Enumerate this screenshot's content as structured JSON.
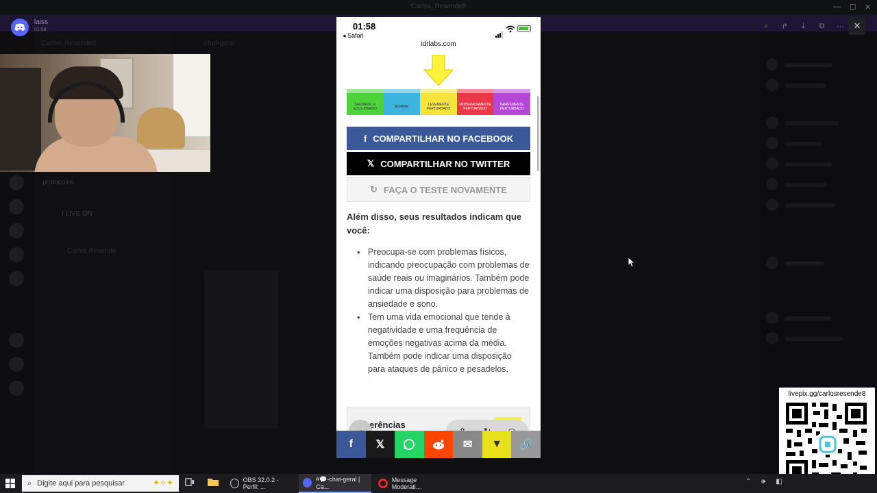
{
  "background": {
    "window_title": "Carlos_Resende8",
    "server_name": "Carlos_Resende8",
    "channel_header": "chat-geral",
    "channel_items": [
      "protocolos",
      "I LIVE ON",
      "Carlos Resende"
    ]
  },
  "notification": {
    "name": "laiss",
    "time": "01:58"
  },
  "phone": {
    "time": "01:58",
    "back_app": "◂ Safari",
    "url": "idrlabs.com",
    "scale": [
      {
        "label": "SAUDÁVEL E EQUILIBRADO",
        "color": "#4fd33d"
      },
      {
        "label": "NORMAL",
        "color": "#3db3e0"
      },
      {
        "label": "LEVEMENTE PERTURBADO",
        "color": "#f4e33a"
      },
      {
        "label": "MODERADAMENTE PERTURBADO",
        "color": "#e8384a"
      },
      {
        "label": "GRAVEMENTE PERTURBADO",
        "color": "#b548d6"
      }
    ],
    "btn_facebook": "COMPARTILHAR NO FACEBOOK",
    "btn_twitter": "COMPARTILHAR NO TWITTER",
    "btn_retry": "FAÇA O TESTE NOVAMENTE",
    "lead": "Além disso, seus resultados indicam que você:",
    "bullets": [
      "Preocupa-se com problemas físicos, indicando preocupação com problemas de saúde reais ou imaginários. Também pode indicar uma disposição para problemas de ansiedade e sono.",
      "Tem uma vida emocional que tende à negatividade e uma frequência de emoções negativas acima da média. Também pode indicar uma disposição para ataques de pânico e pesadelos."
    ],
    "references_title": "erências",
    "share_colors": {
      "facebook": "#3b5998",
      "x": "#1a1a1a",
      "whatsapp": "#25d366",
      "reddit": "#ff4500",
      "email": "#888888",
      "vk": "#e8e01a",
      "link": "#999999"
    }
  },
  "qr": {
    "label": "livepix.gg/carlosresende8"
  },
  "taskbar": {
    "search_placeholder": "Digite aqui para pesquisar",
    "tasks": [
      "OBS 32.0.2 - Perfil: ...",
      "#💬-chat-geral | Ca...",
      "Message Moderati..."
    ]
  }
}
